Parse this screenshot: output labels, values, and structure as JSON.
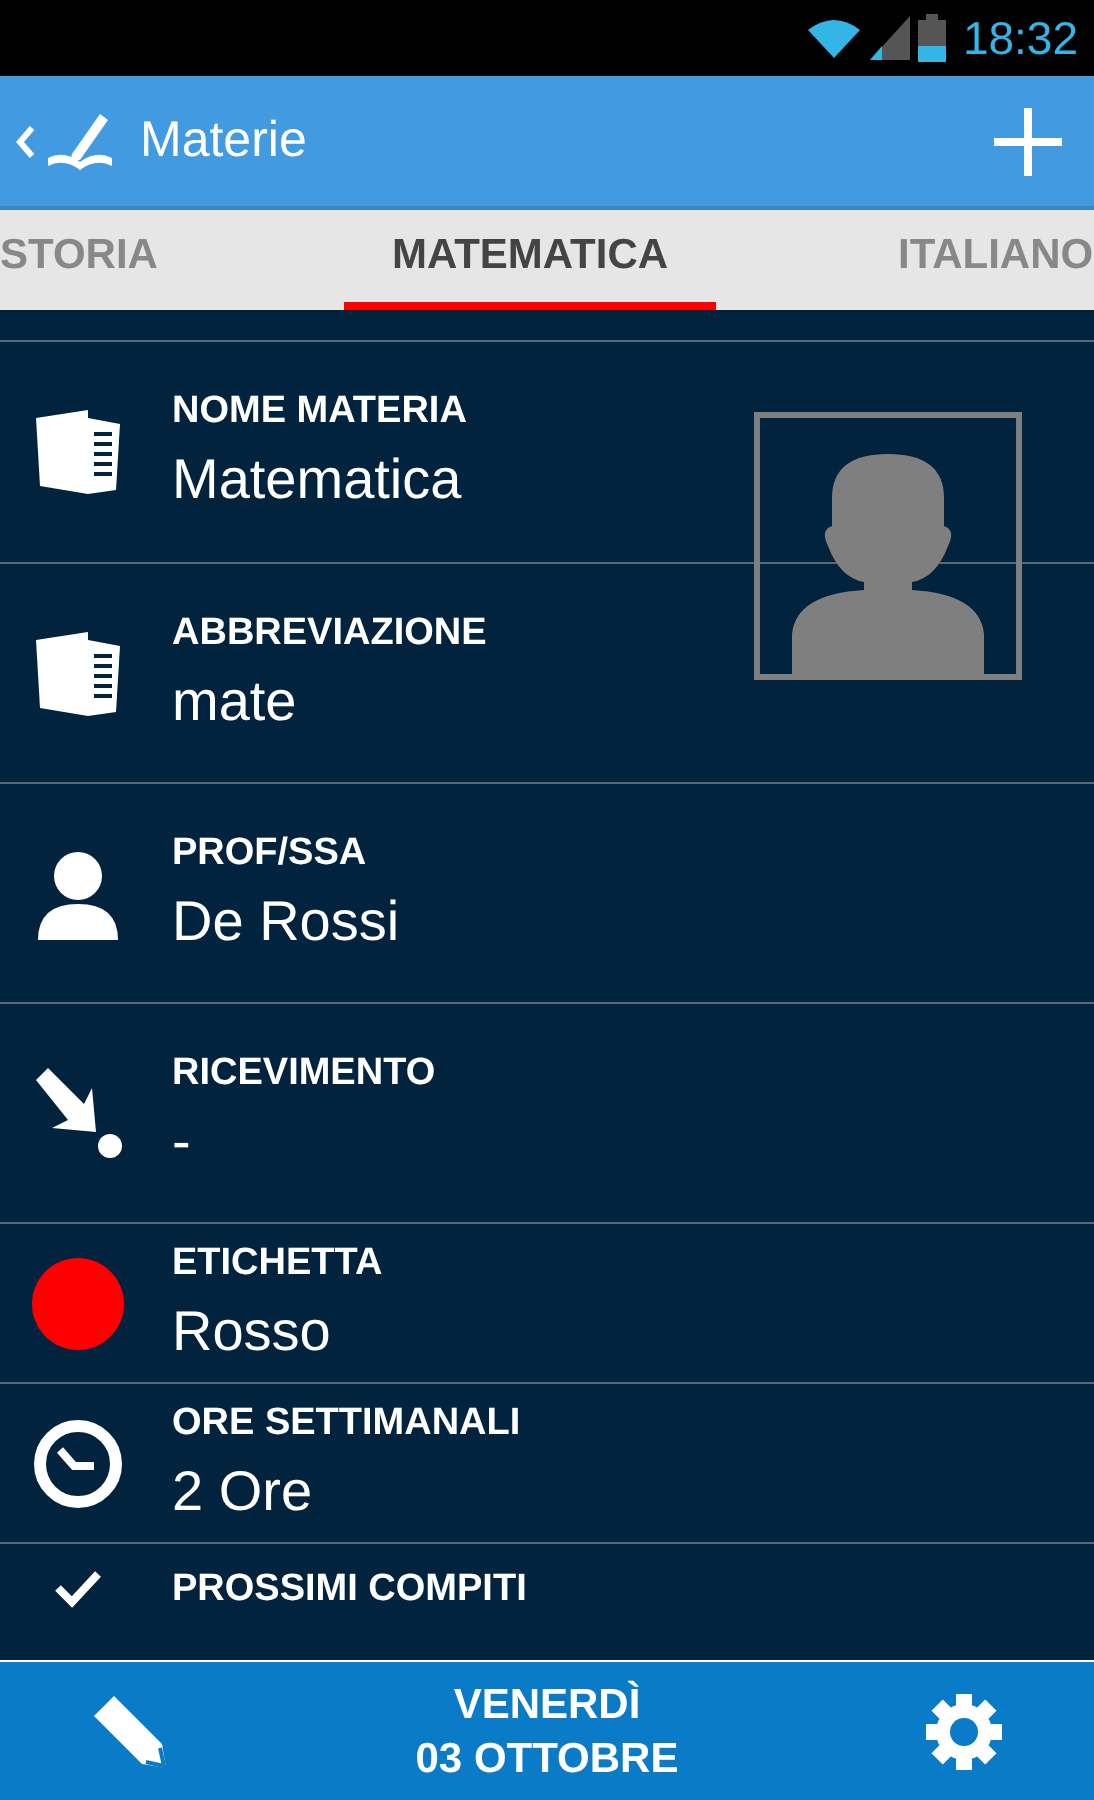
{
  "status_bar": {
    "time": "18:32"
  },
  "app_bar": {
    "title": "Materie"
  },
  "tabs": [
    {
      "label": "STORIA",
      "selected": false
    },
    {
      "label": "MATEMATICA",
      "selected": true
    },
    {
      "label": "ITALIANO",
      "selected": false
    }
  ],
  "fields": [
    {
      "kind": "book",
      "label": "NOME MATERIA",
      "value": "Matematica"
    },
    {
      "kind": "book",
      "label": "ABBREVIAZIONE",
      "value": "mate"
    },
    {
      "kind": "person",
      "label": "PROF/SSA",
      "value": "De Rossi"
    },
    {
      "kind": "arrow",
      "label": "RICEVIMENTO",
      "value": "-"
    },
    {
      "kind": "color",
      "label": "ETICHETTA",
      "value": "Rosso",
      "color": "#ff0000"
    },
    {
      "kind": "clock",
      "label": "ORE SETTIMANALI",
      "value": "2 Ore"
    },
    {
      "kind": "check",
      "label": "PROSSIMI COMPITI"
    }
  ],
  "bottom_bar": {
    "day": "VENERDÌ",
    "date": "03 OTTOBRE"
  }
}
